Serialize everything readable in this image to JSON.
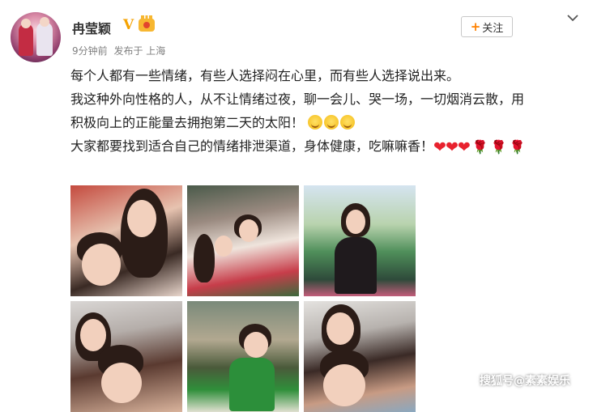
{
  "author": {
    "name": "冉莹颖",
    "verified_badge": "V",
    "time": "9分钟前",
    "source": "发布于 上海"
  },
  "follow_button": {
    "label": "关注"
  },
  "post": {
    "lines": [
      "每个人都有一些情绪，有些人选择闷在心里，而有些人选择说出来。",
      "我这种外向性格的人，从不让情绪过夜，聊一会儿、哭一场，一切烟消云散，用",
      "积极向上的正能量去拥抱第二天的太阳！",
      "大家都要找到适合自己的情绪排泄渠道，身体健康，吃嘛嘛香！"
    ],
    "emojis": [
      "smile",
      "smile",
      "smile",
      "heart",
      "heart",
      "heart",
      "rose",
      "rose",
      "rose"
    ]
  },
  "photos": [
    {
      "name": "photo-1"
    },
    {
      "name": "photo-2"
    },
    {
      "name": "photo-3"
    },
    {
      "name": "photo-4"
    },
    {
      "name": "photo-5"
    },
    {
      "name": "photo-6"
    }
  ],
  "watermark": "搜狐号@素素娱乐",
  "colors": {
    "accent": "#ff8200",
    "badge": "#f5a200",
    "heart": "#e8222e"
  }
}
